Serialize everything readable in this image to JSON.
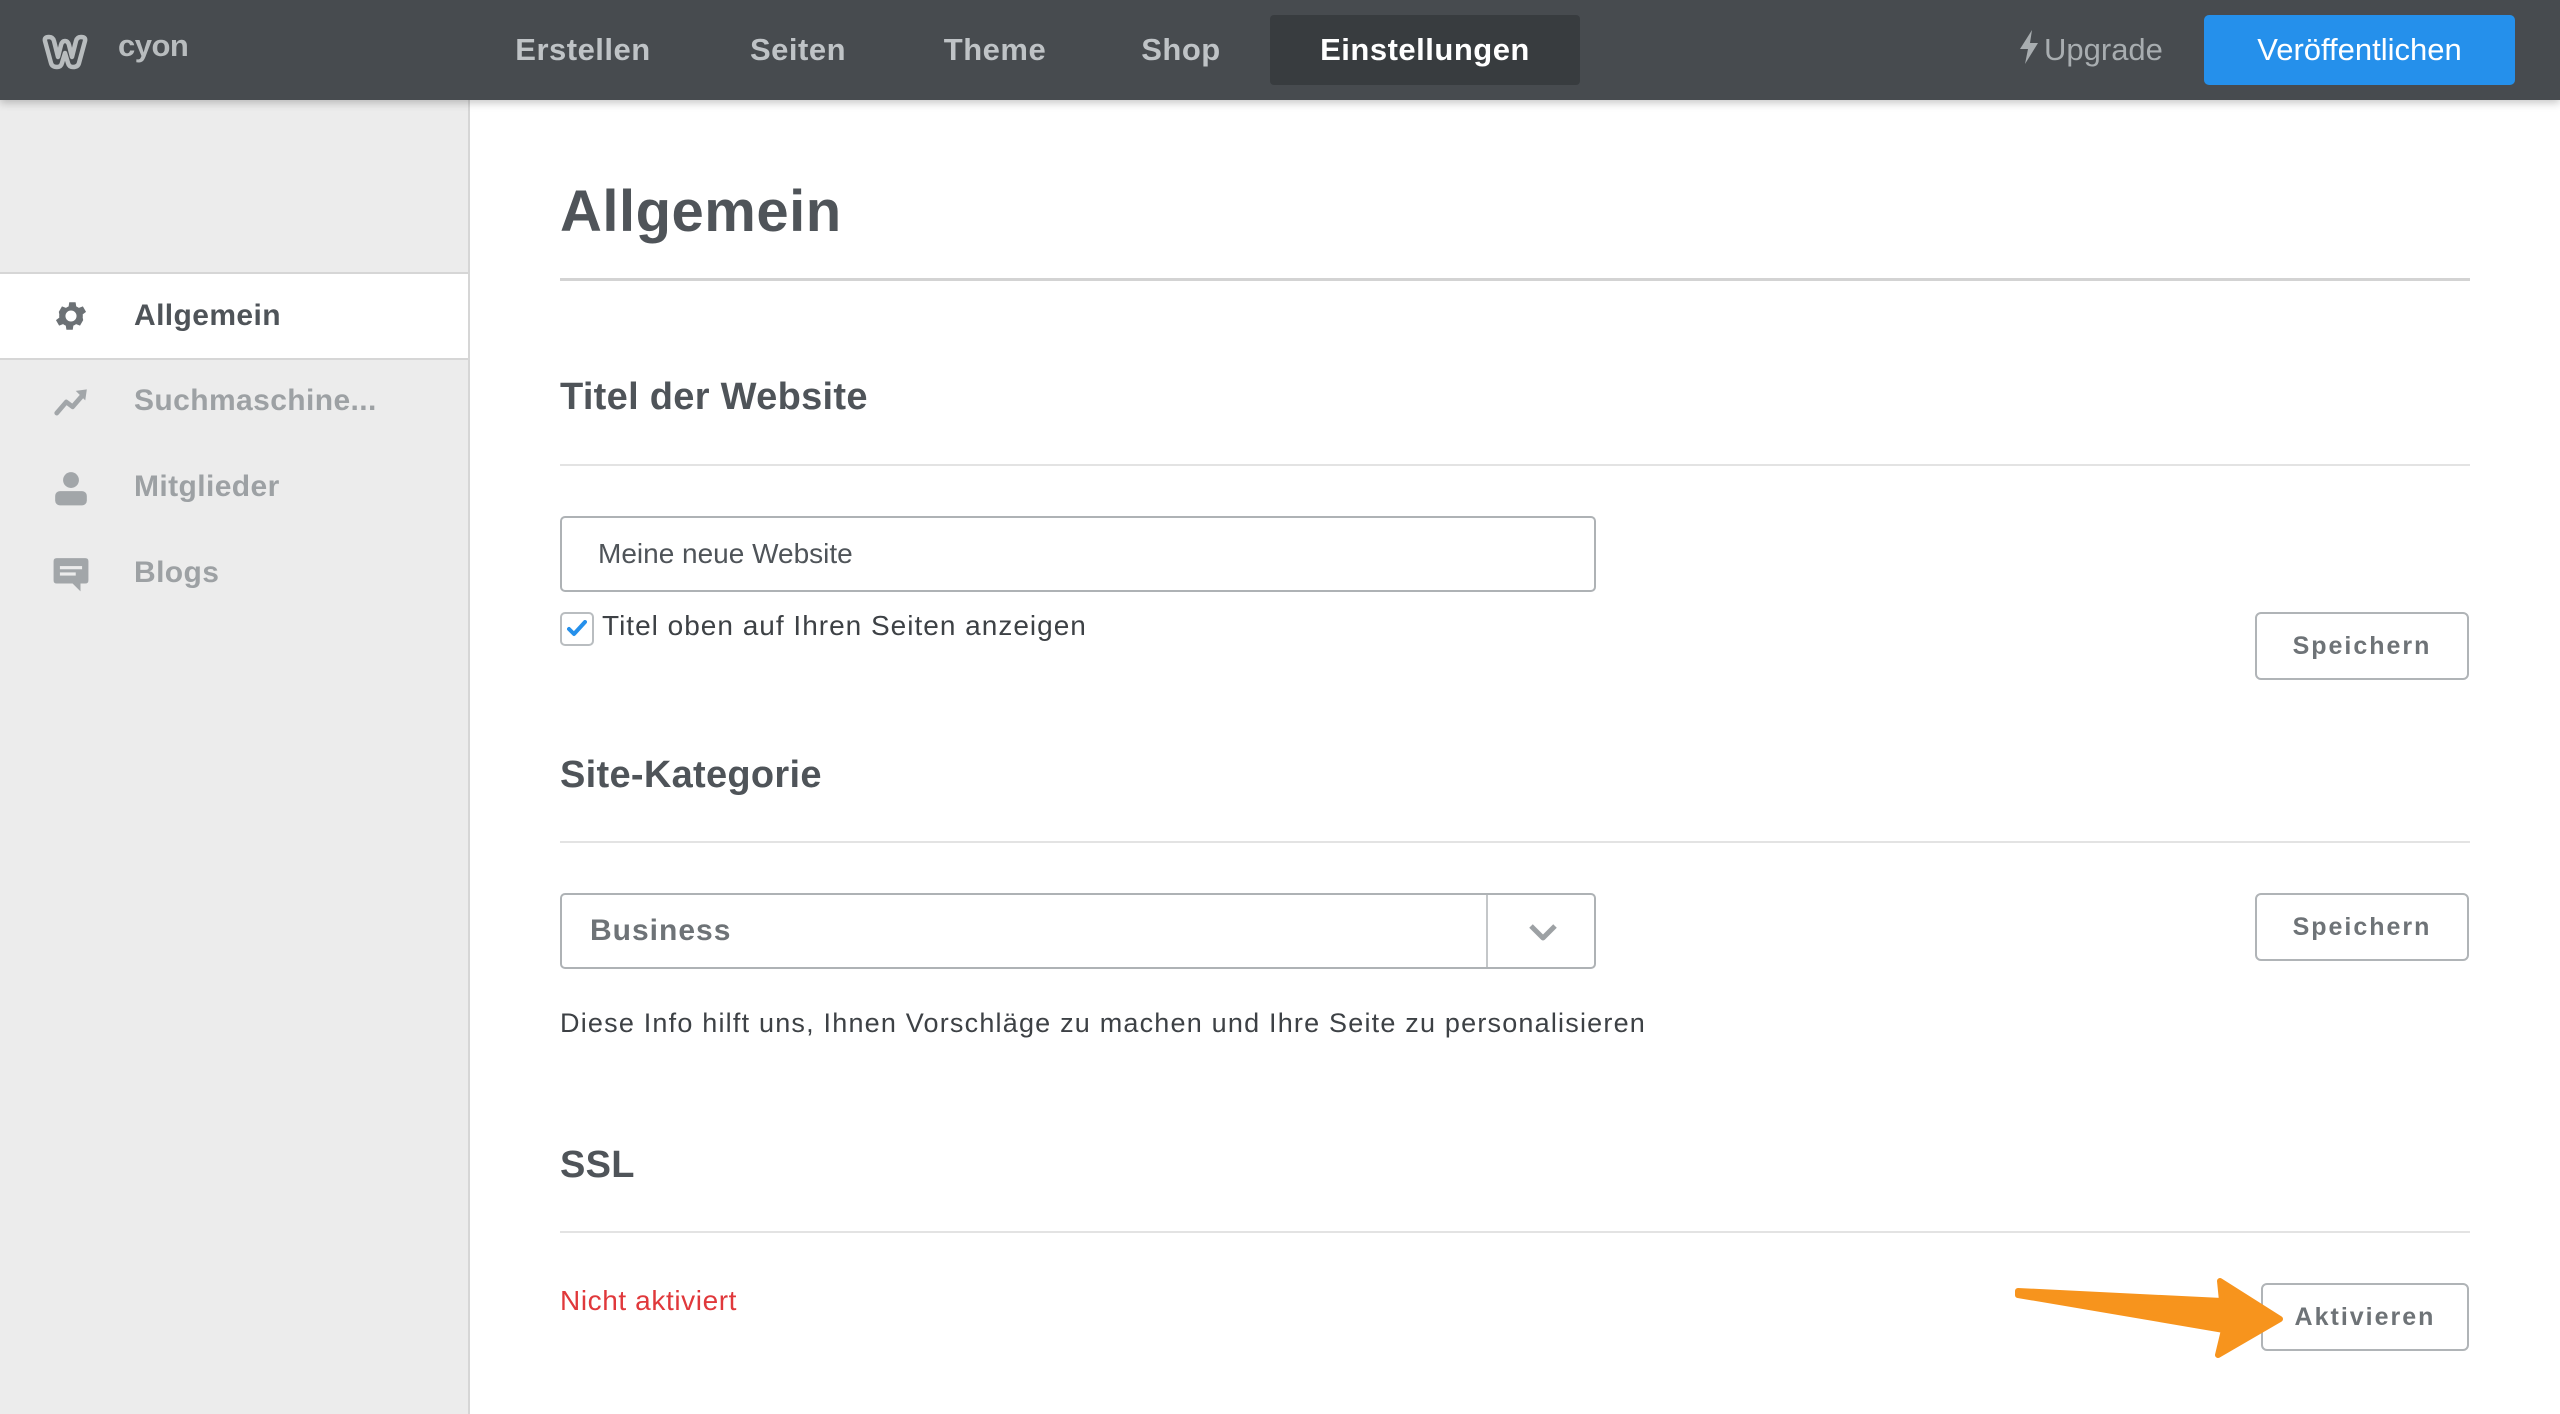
{
  "header": {
    "brand": "cyon",
    "nav": [
      {
        "label": "Erstellen",
        "active": false
      },
      {
        "label": "Seiten",
        "active": false
      },
      {
        "label": "Theme",
        "active": false
      },
      {
        "label": "Shop",
        "active": false
      },
      {
        "label": "Einstellungen",
        "active": true
      }
    ],
    "upgrade_label": "Upgrade",
    "publish_label": "Veröffentlichen",
    "publish_color": "#2590eb"
  },
  "sidebar": {
    "items": [
      {
        "label": "Allgemein",
        "icon": "gear-icon",
        "active": true
      },
      {
        "label": "Suchmaschine...",
        "icon": "trending-up-icon",
        "active": false
      },
      {
        "label": "Mitglieder",
        "icon": "user-icon",
        "active": false
      },
      {
        "label": "Blogs",
        "icon": "comment-icon",
        "active": false
      }
    ]
  },
  "main": {
    "title": "Allgemein",
    "site_title": {
      "heading": "Titel der Website",
      "input_value": "Meine neue Website",
      "checkbox_label": "Titel oben auf Ihren Seiten anzeigen",
      "checkbox_checked": true,
      "save_label": "Speichern"
    },
    "category": {
      "heading": "Site-Kategorie",
      "selected": "Business",
      "help": "Diese Info hilft uns, Ihnen Vorschläge zu machen und Ihre Seite zu personalisieren",
      "save_label": "Speichern"
    },
    "ssl": {
      "heading": "SSL",
      "status": "Nicht aktiviert",
      "status_color": "#e0383b",
      "activate_label": "Aktivieren"
    }
  },
  "annotation": {
    "arrow_color": "#f7941d",
    "points_to": "Aktivieren"
  }
}
